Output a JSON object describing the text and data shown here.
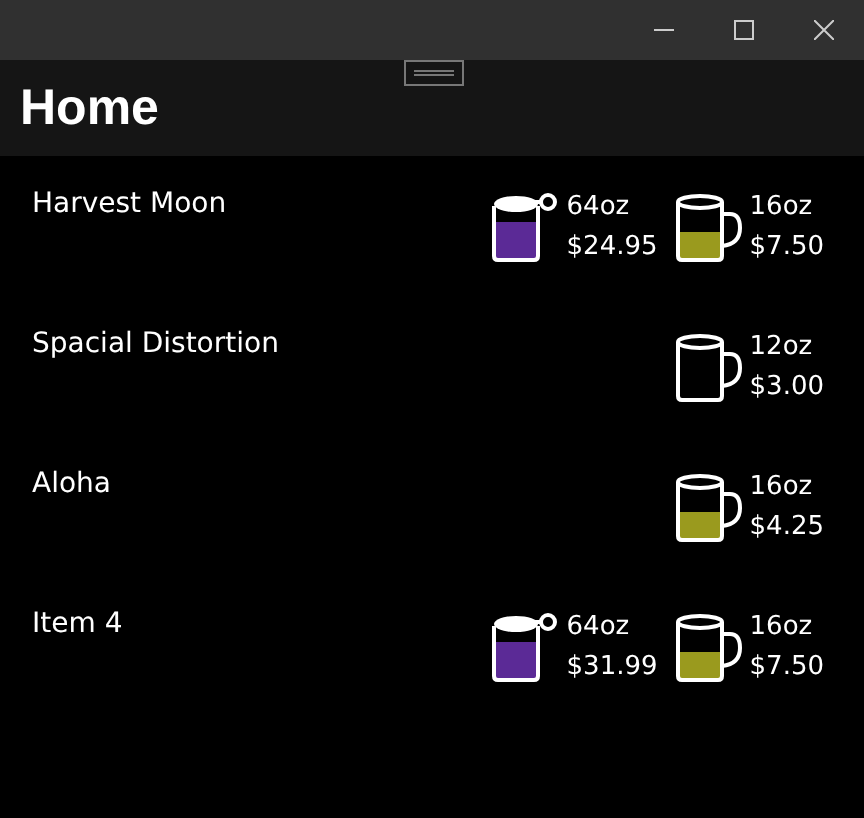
{
  "page": {
    "title": "Home"
  },
  "items": [
    {
      "name": "Harvest Moon",
      "sizes": [
        {
          "kind": "growler",
          "size": "64oz",
          "price": "$24.95",
          "color": "#5b2a96"
        },
        {
          "kind": "mug",
          "size": "16oz",
          "price": "$7.50",
          "color": "#9a9a1e"
        }
      ]
    },
    {
      "name": "Spacial Distortion",
      "sizes": [
        {
          "kind": "mug",
          "size": "12oz",
          "price": "$3.00"
        }
      ]
    },
    {
      "name": "Aloha",
      "sizes": [
        {
          "kind": "mug",
          "size": "16oz",
          "price": "$4.25",
          "color": "#9a9a1e"
        }
      ]
    },
    {
      "name": "Item 4",
      "sizes": [
        {
          "kind": "growler",
          "size": "64oz",
          "price": "$31.99",
          "color": "#5b2a96"
        },
        {
          "kind": "mug",
          "size": "16oz",
          "price": "$7.50",
          "color": "#9a9a1e"
        }
      ]
    }
  ]
}
